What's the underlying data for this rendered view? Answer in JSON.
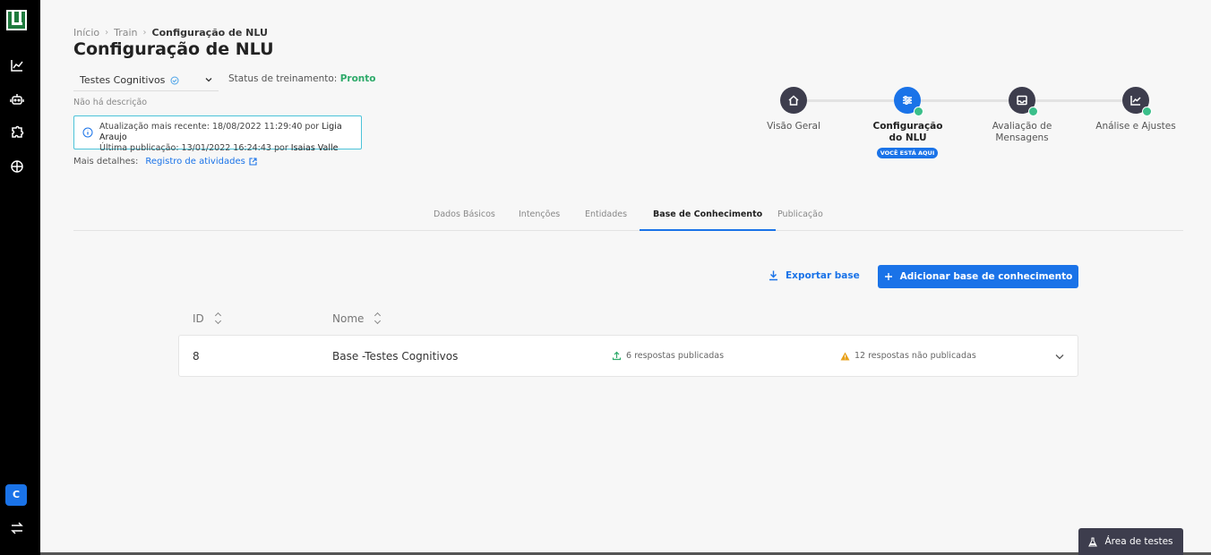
{
  "breadcrumb": {
    "home": "Início",
    "train": "Train",
    "current": "Configuração de NLU"
  },
  "page_title": "Configuração de NLU",
  "project": {
    "selected": "Testes Cognitivos"
  },
  "training": {
    "label": "Status de treinamento:",
    "value": "Pronto"
  },
  "description": "Não há descrição",
  "info": {
    "updated_prefix": "Atualização mais recente: 18/08/2022 11:29:40 por",
    "updated_by": "Ligia Araujo",
    "published_prefix": "Última publicação: 13/01/2022 16:24:43 por",
    "published_by": "Isaias Valle"
  },
  "more_details": {
    "label": "Mais detalhes:",
    "link": "Registro de atividades"
  },
  "stepper": {
    "steps": [
      {
        "label": "Visão Geral"
      },
      {
        "label": "Configuração do NLU"
      },
      {
        "label": "Avaliação de Mensagens"
      },
      {
        "label": "Análise e Ajustes"
      }
    ],
    "here_badge": "VOCÊ ESTÁ AQUI"
  },
  "tabs": [
    "Dados Básicos",
    "Intenções",
    "Entidades",
    "Base de Conhecimento",
    "Publicação"
  ],
  "actions": {
    "export": "Exportar base",
    "add": "Adicionar base de conhecimento"
  },
  "table": {
    "headers": {
      "id": "ID",
      "name": "Nome"
    },
    "rows": [
      {
        "id": "8",
        "name": "Base -Testes Cognitivos",
        "published": "6 respostas publicadas",
        "unpublished": "12 respostas não publicadas"
      }
    ]
  },
  "sidebar": {
    "user_initial": "C"
  },
  "test_area": "Área de testes",
  "colors": {
    "primary": "#1a73e8",
    "success": "#2eaa6a",
    "warning": "#e8a11a",
    "dark": "#3d3d4d"
  }
}
